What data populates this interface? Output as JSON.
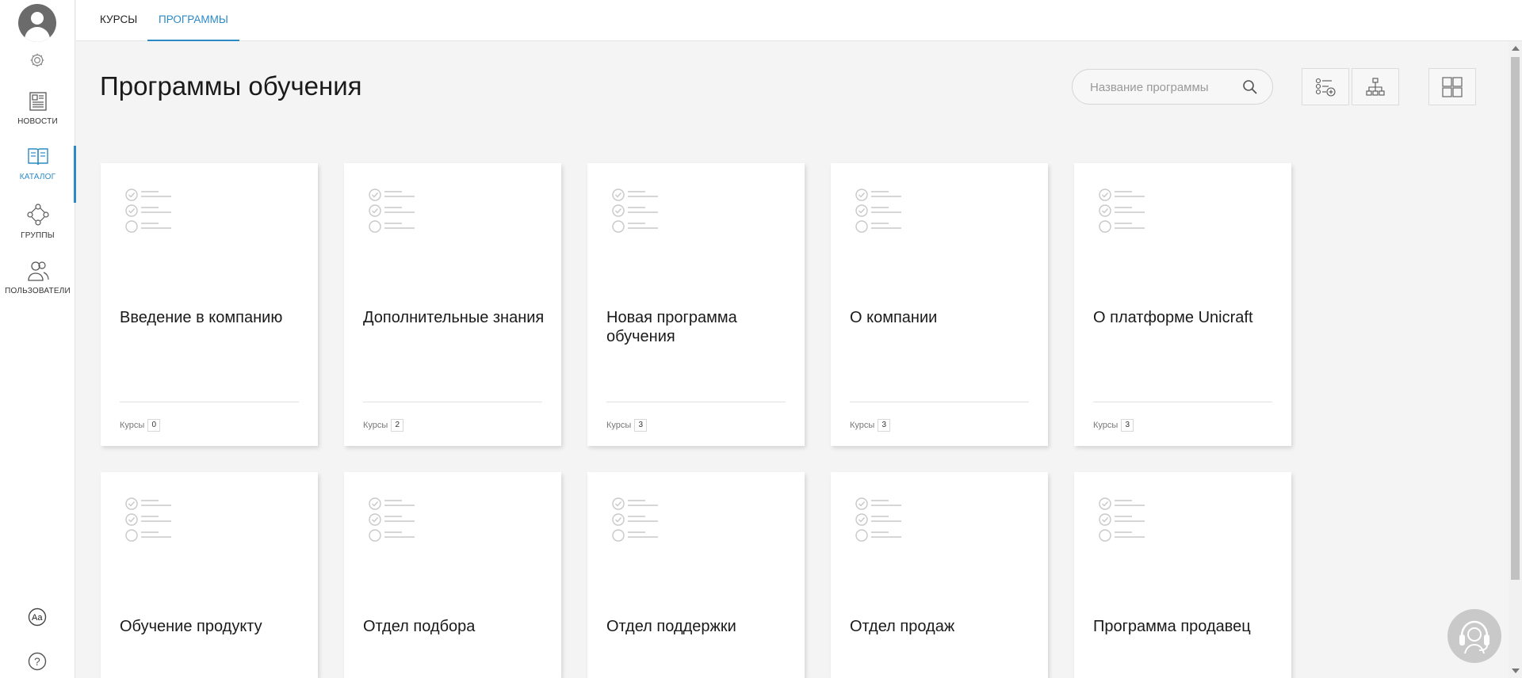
{
  "sidebar": {
    "items": [
      {
        "label": "НОВОСТИ",
        "icon": "newspaper-icon"
      },
      {
        "label": "КАТАЛОГ",
        "icon": "book-icon"
      },
      {
        "label": "ГРУППЫ",
        "icon": "groups-icon"
      },
      {
        "label": "ПОЛЬЗОВАТЕЛИ",
        "icon": "users-icon"
      }
    ],
    "active_index": 1
  },
  "tabs": [
    {
      "label": "КУРСЫ"
    },
    {
      "label": "ПРОГРАММЫ"
    }
  ],
  "header": {
    "title": "Программы обучения",
    "search_placeholder": "Название программы"
  },
  "cards": [
    {
      "title": "Введение в компанию",
      "footer_label": "Курсы",
      "count": "0"
    },
    {
      "title": "Дополнительные знания",
      "footer_label": "Курсы",
      "count": "2"
    },
    {
      "title": "Новая программа обучения",
      "footer_label": "Курсы",
      "count": "3"
    },
    {
      "title": "О компании",
      "footer_label": "Курсы",
      "count": "3"
    },
    {
      "title": "О платформе Unicraft",
      "footer_label": "Курсы",
      "count": "3"
    },
    {
      "title": "Обучение продукту"
    },
    {
      "title": "Отдел подбора"
    },
    {
      "title": "Отдел поддержки"
    },
    {
      "title": "Отдел продаж"
    },
    {
      "title": "Программа продавец"
    }
  ],
  "colors": {
    "accent": "#2b8ac6",
    "background": "#f4f4f4"
  }
}
